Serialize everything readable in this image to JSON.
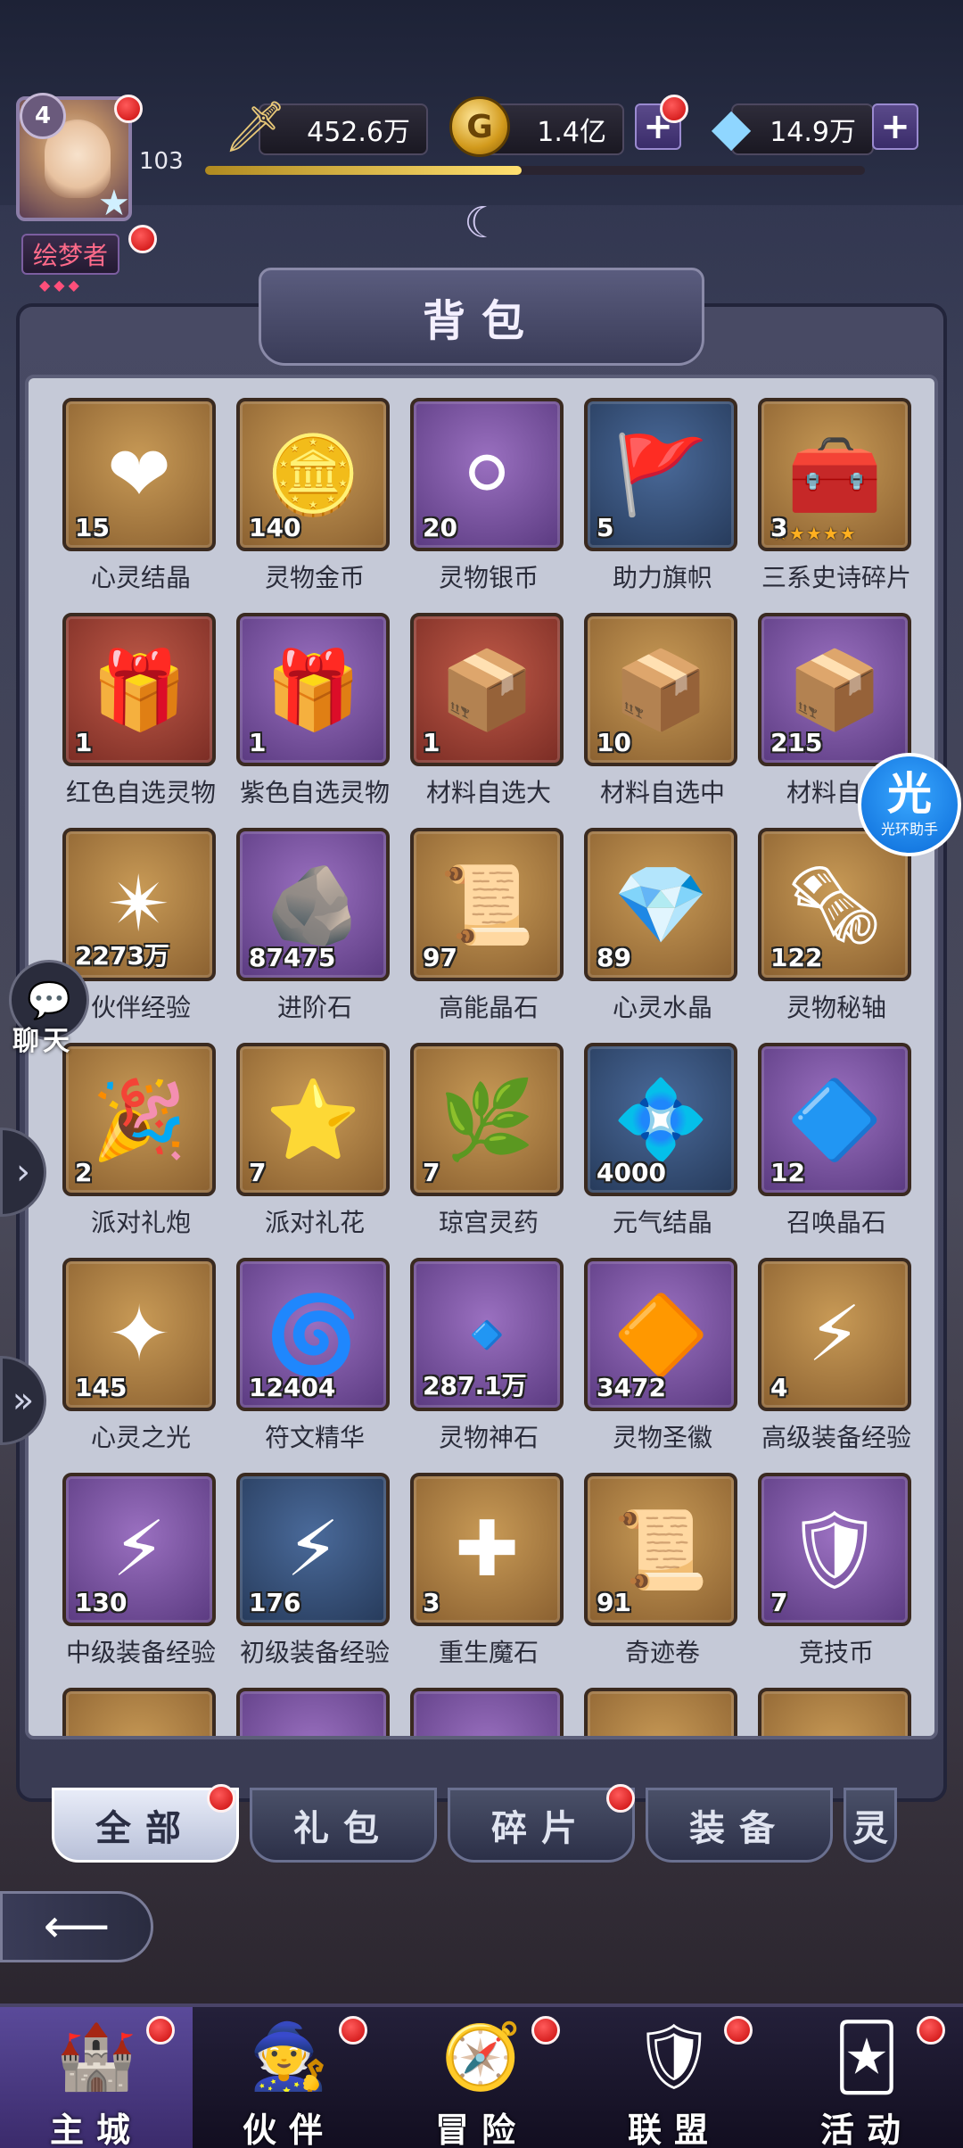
{
  "player": {
    "level": "4",
    "exp_level": "103",
    "title": "绘梦者",
    "exp_progress": 0.48
  },
  "resources": {
    "power": "452.6万",
    "gold": "1.4亿",
    "diamond": "14.9万"
  },
  "panel": {
    "title": "背包"
  },
  "items": [
    {
      "name": "心灵结晶",
      "count": "15",
      "quality": "gold",
      "icon": "❤"
    },
    {
      "name": "灵物金币",
      "count": "140",
      "quality": "gold",
      "icon": "🪙"
    },
    {
      "name": "灵物银币",
      "count": "20",
      "quality": "purple",
      "icon": "⚪"
    },
    {
      "name": "助力旗帜",
      "count": "5",
      "quality": "blue",
      "icon": "🚩"
    },
    {
      "name": "三系史诗碎片",
      "count": "3",
      "quality": "gold",
      "icon": "🧰",
      "stars": "★★★★★"
    },
    {
      "name": "红色自选灵物",
      "count": "1",
      "quality": "red",
      "icon": "🎁"
    },
    {
      "name": "紫色自选灵物",
      "count": "1",
      "quality": "purple",
      "icon": "🎁"
    },
    {
      "name": "材料自选大",
      "count": "1",
      "quality": "red",
      "icon": "📦"
    },
    {
      "name": "材料自选中",
      "count": "10",
      "quality": "gold",
      "icon": "📦"
    },
    {
      "name": "材料自选",
      "count": "215",
      "quality": "purple",
      "icon": "📦"
    },
    {
      "name": "伙伴经验",
      "count": "2273万",
      "quality": "gold",
      "icon": "✴"
    },
    {
      "name": "进阶石",
      "count": "87475",
      "quality": "purple",
      "icon": "🪨"
    },
    {
      "name": "高能晶石",
      "count": "97",
      "quality": "gold",
      "icon": "📜"
    },
    {
      "name": "心灵水晶",
      "count": "89",
      "quality": "gold",
      "icon": "💎"
    },
    {
      "name": "灵物秘轴",
      "count": "122",
      "quality": "gold",
      "icon": "🗞"
    },
    {
      "name": "派对礼炮",
      "count": "2",
      "quality": "gold",
      "icon": "🎉"
    },
    {
      "name": "派对礼花",
      "count": "7",
      "quality": "gold",
      "icon": "⭐"
    },
    {
      "name": "琼宫灵药",
      "count": "7",
      "quality": "gold",
      "icon": "🌿"
    },
    {
      "name": "元气结晶",
      "count": "4000",
      "quality": "blue",
      "icon": "💠"
    },
    {
      "name": "召唤晶石",
      "count": "12",
      "quality": "purple",
      "icon": "🔷"
    },
    {
      "name": "心灵之光",
      "count": "145",
      "quality": "gold",
      "icon": "✦"
    },
    {
      "name": "符文精华",
      "count": "12404",
      "quality": "purple",
      "icon": "🌀"
    },
    {
      "name": "灵物神石",
      "count": "287.1万",
      "quality": "purple",
      "icon": "🔹"
    },
    {
      "name": "灵物圣徽",
      "count": "3472",
      "quality": "purple",
      "icon": "🔶"
    },
    {
      "name": "高级装备经验",
      "count": "4",
      "quality": "gold",
      "icon": "⚡"
    },
    {
      "name": "中级装备经验",
      "count": "130",
      "quality": "purple",
      "icon": "⚡"
    },
    {
      "name": "初级装备经验",
      "count": "176",
      "quality": "blue",
      "icon": "⚡"
    },
    {
      "name": "重生魔石",
      "count": "3",
      "quality": "gold",
      "icon": "✚"
    },
    {
      "name": "奇迹卷",
      "count": "91",
      "quality": "gold",
      "icon": "📜"
    },
    {
      "name": "竞技币",
      "count": "7",
      "quality": "purple",
      "icon": "🛡"
    },
    {
      "name": "",
      "count": "",
      "quality": "gold",
      "icon": ""
    },
    {
      "name": "",
      "count": "",
      "quality": "purple",
      "icon": ""
    },
    {
      "name": "",
      "count": "",
      "quality": "purple",
      "icon": ""
    },
    {
      "name": "",
      "count": "",
      "quality": "gold",
      "icon": ""
    },
    {
      "name": "",
      "count": "",
      "quality": "gold",
      "icon": ""
    }
  ],
  "tabs": [
    {
      "label": "全部",
      "active": true
    },
    {
      "label": "礼包",
      "active": false
    },
    {
      "label": "碎片",
      "active": false
    },
    {
      "label": "装备",
      "active": false
    },
    {
      "label": "灵",
      "active": false
    }
  ],
  "side": {
    "chat_label": "聊天",
    "assist_glyph": "光",
    "assist_label": "光环助手"
  },
  "nav": [
    {
      "label": "主城",
      "icon": "🏰",
      "active": true
    },
    {
      "label": "伙伴",
      "icon": "🧙",
      "active": false
    },
    {
      "label": "冒险",
      "icon": "🧭",
      "active": false
    },
    {
      "label": "联盟",
      "icon": "🛡",
      "active": false
    },
    {
      "label": "活动",
      "icon": "🃏",
      "active": false
    }
  ]
}
